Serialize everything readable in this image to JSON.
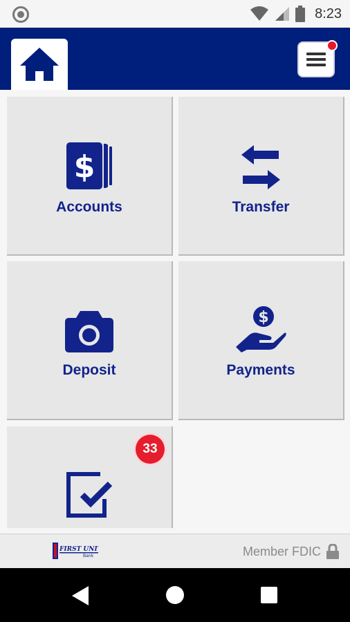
{
  "status_bar": {
    "time": "8:23",
    "icons": [
      "circle-indicator-icon",
      "wifi-icon",
      "cell-signal-icon",
      "battery-icon"
    ]
  },
  "header": {
    "home_icon": "home-icon",
    "menu_icon": "hamburger-menu-icon",
    "menu_has_notification": true,
    "brand_color": "#001e7c"
  },
  "tiles": [
    {
      "label": "Accounts",
      "icon": "accounts-dollar-cards-icon"
    },
    {
      "label": "Transfer",
      "icon": "transfer-arrows-icon"
    },
    {
      "label": "Deposit",
      "icon": "camera-icon"
    },
    {
      "label": "Payments",
      "icon": "hand-coin-icon"
    },
    {
      "label": "",
      "icon": "checkbox-task-icon",
      "badge": "33"
    }
  ],
  "footer": {
    "logo_text": "FIRST UNITED",
    "logo_subtext": "Bank",
    "member_text": "Member FDIC",
    "lock_icon": "lock-icon"
  },
  "colors": {
    "accent": "#12238c",
    "badge": "#e51d2c",
    "tile_bg": "#e7e7e7"
  }
}
